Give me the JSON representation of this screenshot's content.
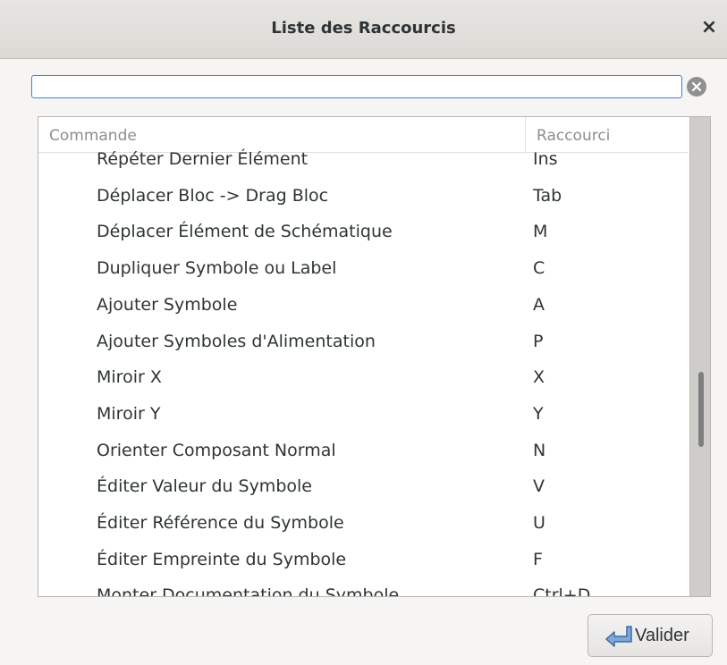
{
  "window": {
    "title": "Liste des Raccourcis",
    "close_glyph": "×"
  },
  "search": {
    "value": "",
    "placeholder": ""
  },
  "list": {
    "columns": {
      "command": "Commande",
      "shortcut": "Raccourci"
    },
    "rows": [
      {
        "command": "Répéter Dernier Élément",
        "shortcut": "Ins"
      },
      {
        "command": "Déplacer Bloc -> Drag Bloc",
        "shortcut": "Tab"
      },
      {
        "command": "Déplacer Élément de Schématique",
        "shortcut": "M"
      },
      {
        "command": "Dupliquer Symbole ou Label",
        "shortcut": "C"
      },
      {
        "command": "Ajouter Symbole",
        "shortcut": "A"
      },
      {
        "command": "Ajouter Symboles d'Alimentation",
        "shortcut": "P"
      },
      {
        "command": "Miroir X",
        "shortcut": "X"
      },
      {
        "command": "Miroir Y",
        "shortcut": "Y"
      },
      {
        "command": "Orienter Composant Normal",
        "shortcut": "N"
      },
      {
        "command": "Éditer Valeur du Symbole",
        "shortcut": "V"
      },
      {
        "command": "Éditer Référence du Symbole",
        "shortcut": "U"
      },
      {
        "command": "Éditer Empreinte du Symbole",
        "shortcut": "F"
      },
      {
        "command": "Monter Documentation du Symbole",
        "shortcut": "Ctrl+D"
      }
    ]
  },
  "footer": {
    "ok_label": "Valider",
    "ok_icon": "enter-arrow-icon"
  },
  "colors": {
    "accent": "#3584e4",
    "header_text": "#8b8e8f",
    "text": "#2e3436"
  }
}
